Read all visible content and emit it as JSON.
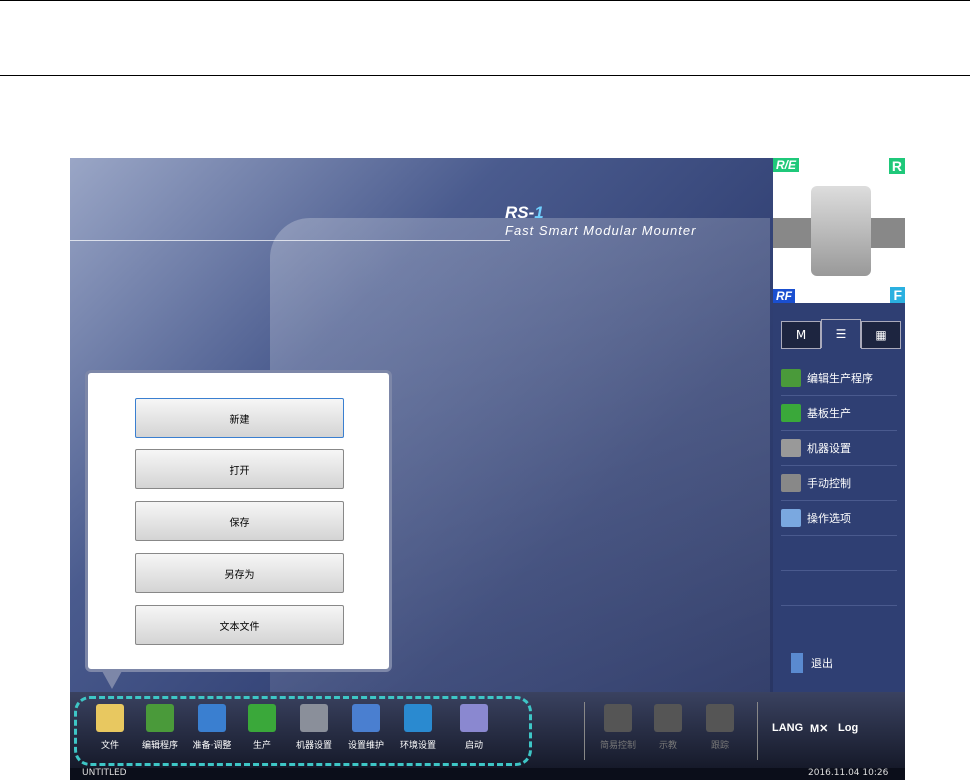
{
  "brand": {
    "model_prefix": "RS-",
    "model_num": "1",
    "subtitle": "Fast Smart Modular Mounter"
  },
  "preview": {
    "corners": {
      "top_left": "R/E",
      "top_right": "R",
      "bottom_left": "RF",
      "bottom_right": "F"
    }
  },
  "right_tabs": [
    {
      "icon": "manual-tool-icon",
      "label": "M"
    },
    {
      "icon": "list-icon",
      "active": true
    },
    {
      "icon": "grid-icon"
    }
  ],
  "right_menu": [
    "编辑生产程序",
    "基板生产",
    "机器设置",
    "手动控制",
    "操作选项"
  ],
  "exit_label": "退出",
  "popup": {
    "buttons": [
      "新建",
      "打开",
      "保存",
      "另存为",
      "文本文件"
    ],
    "selected": 0
  },
  "toolbar": {
    "main": [
      {
        "label": "文件",
        "icon": "folder-icon",
        "color": "#e8c860"
      },
      {
        "label": "编辑程序",
        "icon": "edit-program-icon",
        "color": "#4a9a3a"
      },
      {
        "label": "准备·调整",
        "icon": "machine-info-icon",
        "color": "#3a7fd0"
      },
      {
        "label": "生产",
        "icon": "production-icon",
        "color": "#3aa83a"
      },
      {
        "label": "机器设置",
        "icon": "machine-gear-icon",
        "color": "#8a8f9a"
      },
      {
        "label": "设置维护",
        "icon": "tools-icon",
        "color": "#4a7fd0"
      },
      {
        "label": "环境设置",
        "icon": "globe-gear-icon",
        "color": "#2a8ad0"
      },
      {
        "label": "启动",
        "icon": "book-icon",
        "color": "#8a88d0"
      }
    ],
    "disabled": [
      {
        "label": "简易控制",
        "icon": "simple-control-icon"
      },
      {
        "label": "示教",
        "icon": "teach-icon"
      },
      {
        "label": "跟踪",
        "icon": "trace-icon"
      }
    ],
    "system": [
      {
        "label": "LANG",
        "icon": "language-icon"
      },
      {
        "label": "M",
        "icon": "manual-tool-icon"
      },
      {
        "label": "Log",
        "icon": "log-icon"
      }
    ]
  },
  "status": {
    "filename": "UNTITLED",
    "datetime": "2016.11.04 10:26"
  },
  "colors": {
    "highlight": "#3ec6c6",
    "corner_green": "#1fc87a",
    "corner_blue": "#1a4fd0"
  }
}
